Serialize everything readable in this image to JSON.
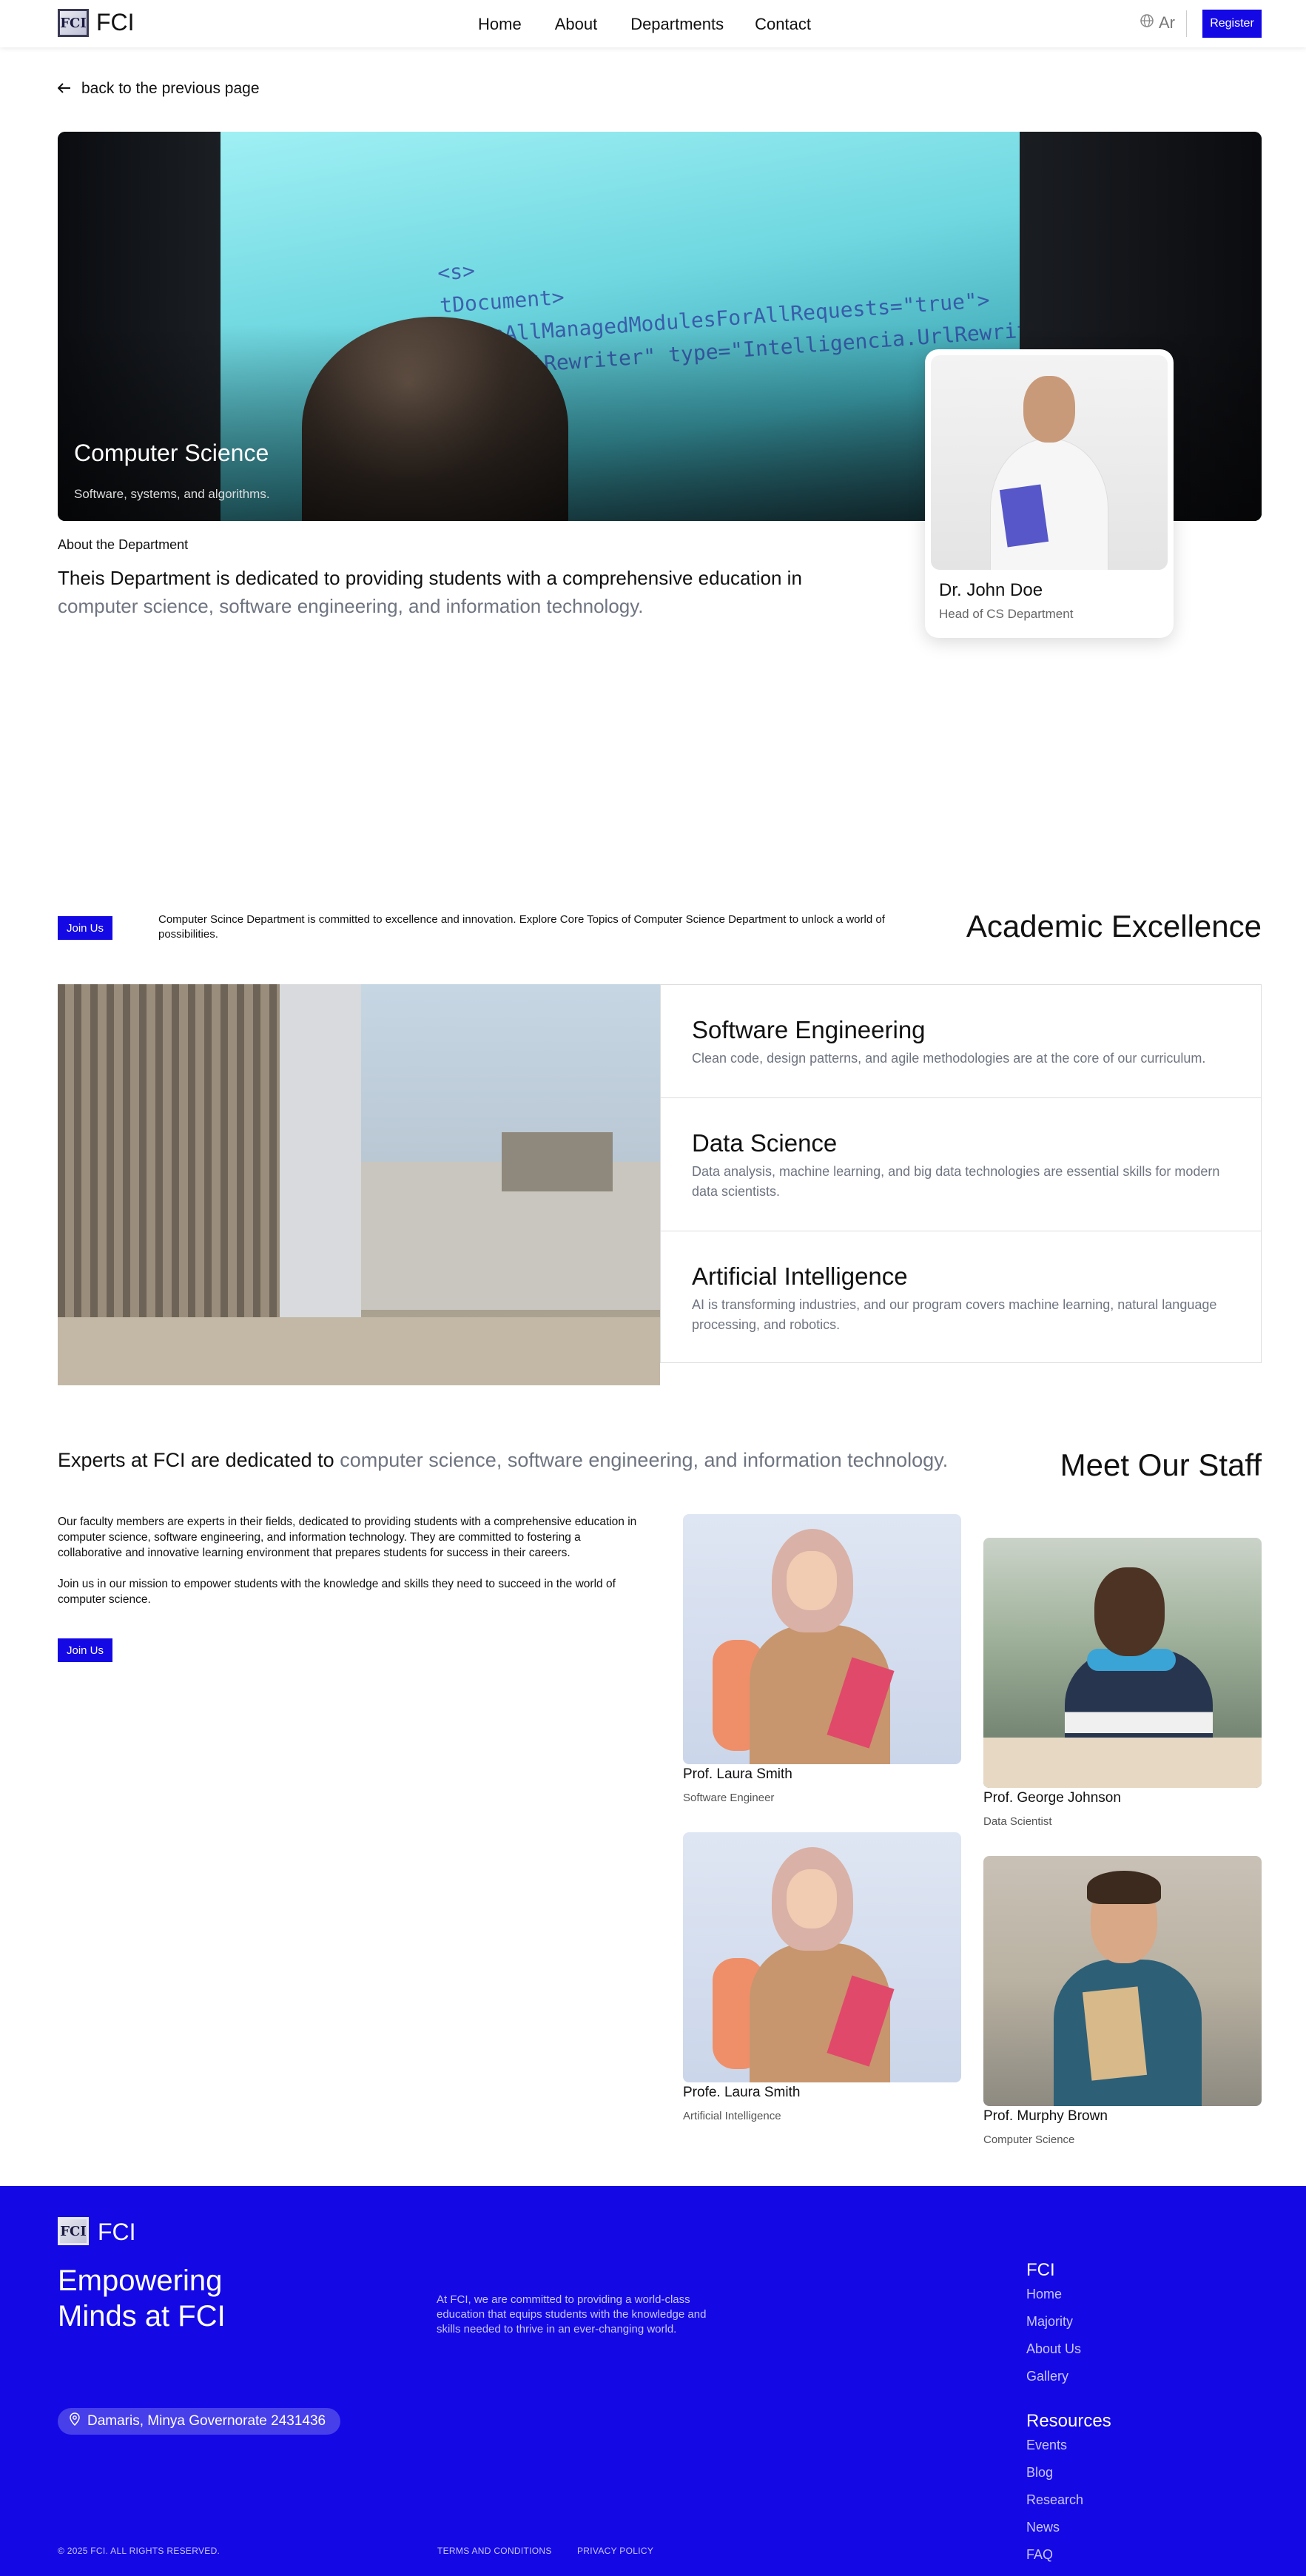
{
  "nav": {
    "logo_mark": "FCI",
    "logo_text": "FCI",
    "links": [
      "Home",
      "About",
      "Departments",
      "Contact"
    ],
    "lang": "Ar",
    "lang_icon": "globe-icon",
    "register": "Register"
  },
  "back": {
    "icon": "arrow-left-icon",
    "label": "back to the previous page"
  },
  "hero": {
    "title": "Computer Science",
    "subtitle": "Software, systems, and algorithms."
  },
  "dean": {
    "name": "Dr. John Doe",
    "role": "Head of CS Department"
  },
  "about": {
    "label": "About the Department",
    "text_main": "Theis Department is dedicated to providing students with a comprehensive education in",
    "text_muted": "computer science, software engineering, and information technology."
  },
  "academic": {
    "join": "Join Us",
    "desc": "Computer Scince Department is committed to excellence and innovation. Explore Core Topics of Computer Science Department to unlock a world of possibilities.",
    "title": "Academic Excellence",
    "topics": [
      {
        "title": "Software Engineering",
        "desc": "Clean code, design patterns, and agile methodologies are at the core of our curriculum."
      },
      {
        "title": "Data Science",
        "desc": "Data analysis, machine learning, and big data technologies are essential skills for modern data scientists."
      },
      {
        "title": "Artificial Intelligence",
        "desc": "AI is transforming industries, and our program covers machine learning, natural language processing, and robotics."
      }
    ]
  },
  "staff": {
    "intro_main": "Experts at FCI are dedicated to",
    "intro_muted": "computer science, software engineering, and information technology.",
    "title": "Meet Our Staff",
    "p1": "Our faculty members are experts in their fields, dedicated to providing students with a comprehensive education in computer science, software engineering, and information technology. They are committed to fostering a collaborative and innovative learning environment that prepares students for success in their careers.",
    "p2": "Join us in our mission to empower students with the knowledge and skills they need to succeed in the world of computer science.",
    "join": "Join Us",
    "members": [
      {
        "name": "Prof. Laura Smith",
        "role": "Software Engineer"
      },
      {
        "name": "Prof. George Johnson",
        "role": "Data Scientist"
      },
      {
        "name": "Profe. Laura Smith",
        "role": "Artificial Intelligence"
      },
      {
        "name": "Prof. Murphy Brown",
        "role": "Computer Science"
      }
    ]
  },
  "footer": {
    "logo_text": "FCI",
    "tagline": "Empowering Minds at FCI",
    "desc": "At FCI, we are committed to providing a world-class education that equips students with the knowledge and skills needed to thrive in an ever-changing world.",
    "address_icon": "location-pin-icon",
    "address": "Damaris, Minya Governorate 2431436",
    "col1_title": "FCI",
    "col1_links": [
      "Home",
      "Majority",
      "About Us",
      "Gallery"
    ],
    "col2_title": "Resources",
    "col2_links": [
      "Events",
      "Blog",
      "Research",
      "News",
      "FAQ"
    ],
    "copyright": "© 2025 FCI. ALL RIGHTS RESERVED.",
    "terms": "TERMS AND CONDITIONS",
    "privacy": "PRIVACY POLICY"
  },
  "colors": {
    "brand": "#1409e4",
    "muted": "#6e7480"
  }
}
